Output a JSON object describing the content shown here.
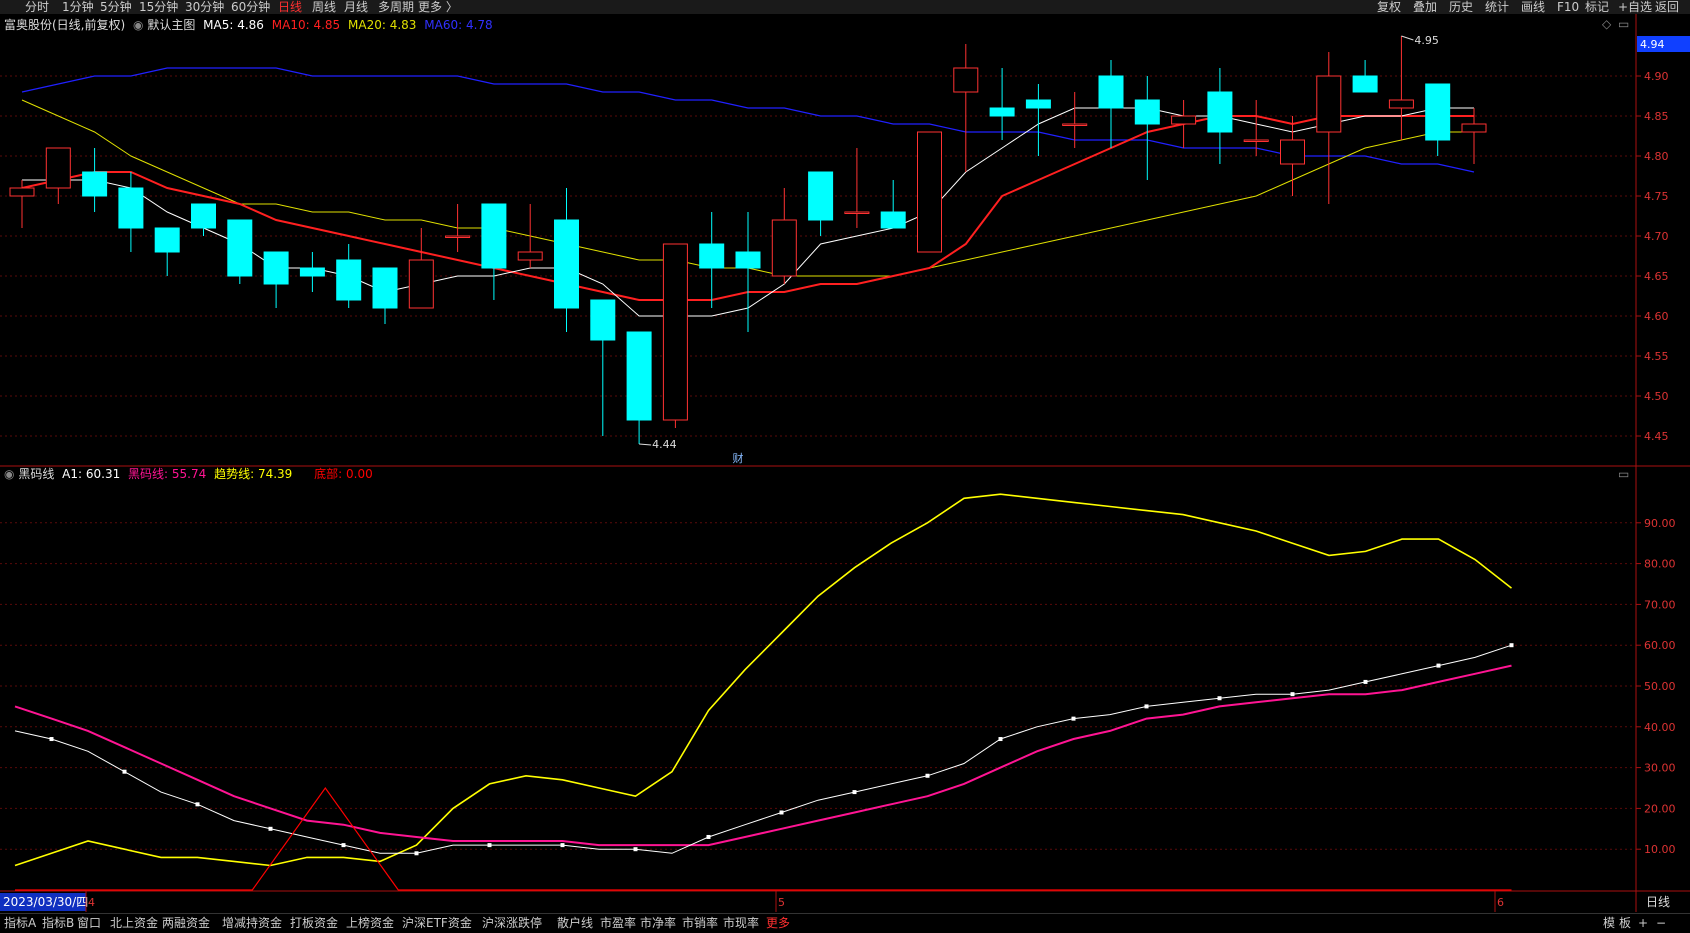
{
  "toolbar": {
    "periods": [
      "分时",
      "1分钟",
      "5分钟",
      "15分钟",
      "30分钟",
      "60分钟",
      "日线",
      "周线",
      "月线",
      "多周期",
      "更多 〉"
    ],
    "active_period": "日线",
    "right": [
      "复权",
      "叠加",
      "历史",
      "统计",
      "画线",
      "F10",
      "标记",
      "+自选",
      "返回"
    ]
  },
  "main_info": {
    "title": "富奥股份(日线,前复权)",
    "template": "默认主图",
    "ma5": "MA5: 4.86",
    "ma10": "MA10: 4.85",
    "ma20": "MA20: 4.83",
    "ma60": "MA60: 4.78"
  },
  "sub_info": {
    "name": "黑码线",
    "a1": "A1: 60.31",
    "heima": "黑码线: 55.74",
    "qushi": "趋势线: 74.39",
    "dibu": "底部: 0.00"
  },
  "price_axis": {
    "current": "4.94",
    "ticks": [
      4.9,
      4.85,
      4.8,
      4.75,
      4.7,
      4.65,
      4.6,
      4.55,
      4.5,
      4.45
    ],
    "range": [
      4.42,
      4.96
    ]
  },
  "ind_axis": {
    "ticks": [
      90,
      80,
      70,
      60,
      50,
      40,
      30,
      20,
      10
    ],
    "range": [
      0,
      100
    ]
  },
  "markers": {
    "high": "4.95",
    "low": "4.44",
    "cai": "财"
  },
  "date_axis": {
    "cursor_date": "2023/03/30/四",
    "month_labels": [
      "4",
      "5",
      "6"
    ],
    "right_label": "日线"
  },
  "bottom_tabs": [
    "指标A",
    "指标B",
    "窗口",
    "北上资金",
    "两融资金",
    "增减持资金",
    "打板资金",
    "上榜资金",
    "沪深ETF资金",
    "沪深涨跌停",
    "散户线",
    "市盈率",
    "市净率",
    "市销率",
    "市现率",
    "更多"
  ],
  "bottom_right": [
    "模",
    "板",
    "+",
    "−"
  ],
  "colors": {
    "up": "#ff3232",
    "down": "#00ffff",
    "ma5": "#ffffff",
    "ma10": "#ff2020",
    "ma20": "#e0e000",
    "ma60": "#2020ff",
    "a1": "#ffffff",
    "heima": "#ff1493",
    "qushi": "#ffff00",
    "dibu": "#ff0000"
  },
  "chart_data": {
    "type": "candlestick",
    "candles": [
      [
        4.75,
        4.76,
        4.71,
        4.77
      ],
      [
        4.76,
        4.81,
        4.74,
        4.81
      ],
      [
        4.78,
        4.75,
        4.73,
        4.81
      ],
      [
        4.76,
        4.71,
        4.68,
        4.78
      ],
      [
        4.71,
        4.68,
        4.65,
        4.71
      ],
      [
        4.74,
        4.71,
        4.7,
        4.74
      ],
      [
        4.72,
        4.65,
        4.64,
        4.72
      ],
      [
        4.68,
        4.64,
        4.61,
        4.68
      ],
      [
        4.66,
        4.65,
        4.63,
        4.68
      ],
      [
        4.67,
        4.62,
        4.61,
        4.69
      ],
      [
        4.66,
        4.61,
        4.59,
        4.66
      ],
      [
        4.61,
        4.67,
        4.61,
        4.71
      ],
      [
        4.7,
        4.7,
        4.68,
        4.74
      ],
      [
        4.74,
        4.66,
        4.62,
        4.74
      ],
      [
        4.67,
        4.68,
        4.66,
        4.74
      ],
      [
        4.72,
        4.61,
        4.58,
        4.76
      ],
      [
        4.62,
        4.57,
        4.45,
        4.62
      ],
      [
        4.58,
        4.47,
        4.44,
        4.58
      ],
      [
        4.47,
        4.69,
        4.46,
        4.69
      ],
      [
        4.69,
        4.66,
        4.61,
        4.73
      ],
      [
        4.68,
        4.66,
        4.58,
        4.73
      ],
      [
        4.65,
        4.72,
        4.64,
        4.76
      ],
      [
        4.78,
        4.72,
        4.7,
        4.78
      ],
      [
        4.73,
        4.73,
        4.71,
        4.81
      ],
      [
        4.73,
        4.71,
        4.71,
        4.77
      ],
      [
        4.68,
        4.83,
        4.68,
        4.83
      ],
      [
        4.88,
        4.91,
        4.78,
        4.94
      ],
      [
        4.86,
        4.85,
        4.82,
        4.91
      ],
      [
        4.87,
        4.86,
        4.8,
        4.89
      ],
      [
        4.84,
        4.84,
        4.81,
        4.88
      ],
      [
        4.9,
        4.86,
        4.81,
        4.92
      ],
      [
        4.87,
        4.84,
        4.77,
        4.9
      ],
      [
        4.84,
        4.85,
        4.81,
        4.87
      ],
      [
        4.88,
        4.83,
        4.79,
        4.91
      ],
      [
        4.82,
        4.82,
        4.8,
        4.87
      ],
      [
        4.79,
        4.82,
        4.75,
        4.85
      ],
      [
        4.83,
        4.9,
        4.74,
        4.93
      ],
      [
        4.9,
        4.88,
        4.88,
        4.92
      ],
      [
        4.86,
        4.87,
        4.82,
        4.95
      ],
      [
        4.89,
        4.82,
        4.8,
        4.89
      ],
      [
        4.83,
        4.84,
        4.79,
        4.86
      ]
    ],
    "ma5": [
      4.77,
      4.77,
      4.77,
      4.76,
      4.73,
      4.71,
      4.69,
      4.66,
      4.66,
      4.65,
      4.63,
      4.64,
      4.65,
      4.65,
      4.66,
      4.66,
      4.64,
      4.6,
      4.6,
      4.6,
      4.61,
      4.64,
      4.69,
      4.7,
      4.71,
      4.73,
      4.78,
      4.81,
      4.84,
      4.86,
      4.86,
      4.86,
      4.85,
      4.85,
      4.84,
      4.83,
      4.84,
      4.85,
      4.85,
      4.86,
      4.86
    ],
    "ma10": [
      4.76,
      4.77,
      4.78,
      4.78,
      4.76,
      4.75,
      4.74,
      4.72,
      4.71,
      4.7,
      4.69,
      4.68,
      4.67,
      4.66,
      4.65,
      4.64,
      4.63,
      4.62,
      4.62,
      4.62,
      4.63,
      4.63,
      4.64,
      4.64,
      4.65,
      4.66,
      4.69,
      4.75,
      4.77,
      4.79,
      4.81,
      4.83,
      4.84,
      4.85,
      4.85,
      4.84,
      4.85,
      4.85,
      4.85,
      4.85,
      4.85
    ],
    "ma20": [
      4.87,
      4.85,
      4.83,
      4.8,
      4.78,
      4.76,
      4.74,
      4.74,
      4.73,
      4.73,
      4.72,
      4.72,
      4.71,
      4.71,
      4.7,
      4.69,
      4.68,
      4.67,
      4.67,
      4.66,
      4.66,
      4.65,
      4.65,
      4.65,
      4.65,
      4.66,
      4.67,
      4.68,
      4.69,
      4.7,
      4.71,
      4.72,
      4.73,
      4.74,
      4.75,
      4.77,
      4.79,
      4.81,
      4.82,
      4.83,
      4.83
    ],
    "ma60": [
      4.88,
      4.89,
      4.9,
      4.9,
      4.91,
      4.91,
      4.91,
      4.91,
      4.9,
      4.9,
      4.9,
      4.9,
      4.9,
      4.89,
      4.89,
      4.89,
      4.88,
      4.88,
      4.87,
      4.87,
      4.86,
      4.86,
      4.85,
      4.85,
      4.84,
      4.84,
      4.83,
      4.83,
      4.83,
      4.82,
      4.82,
      4.82,
      4.81,
      4.81,
      4.81,
      4.8,
      4.8,
      4.8,
      4.79,
      4.79,
      4.78
    ],
    "a1": [
      39,
      37,
      34,
      29,
      24,
      21,
      17,
      15,
      13,
      11,
      9,
      9,
      11,
      11,
      11,
      11,
      10,
      10,
      9,
      13,
      16,
      19,
      22,
      24,
      26,
      28,
      31,
      37,
      40,
      42,
      43,
      45,
      46,
      47,
      48,
      48,
      49,
      51,
      53,
      55,
      57,
      60
    ],
    "heima": [
      45,
      42,
      39,
      35,
      31,
      27,
      23,
      20,
      17,
      16,
      14,
      13,
      12,
      12,
      12,
      12,
      11,
      11,
      11,
      11,
      13,
      15,
      17,
      19,
      21,
      23,
      26,
      30,
      34,
      37,
      39,
      42,
      43,
      45,
      46,
      47,
      48,
      48,
      49,
      51,
      53,
      55
    ],
    "qushi": [
      6,
      9,
      12,
      10,
      8,
      8,
      7,
      6,
      8,
      8,
      7,
      11,
      20,
      26,
      28,
      27,
      25,
      23,
      29,
      44,
      54,
      63,
      72,
      79,
      85,
      90,
      96,
      97,
      96,
      95,
      94,
      93,
      92,
      90,
      88,
      85,
      82,
      83,
      86,
      86,
      81,
      74
    ],
    "dibu": [
      [
        0,
        0
      ],
      [
        6.5,
        0
      ],
      [
        8.5,
        25
      ],
      [
        10.5,
        0
      ],
      [
        41,
        0
      ]
    ]
  }
}
